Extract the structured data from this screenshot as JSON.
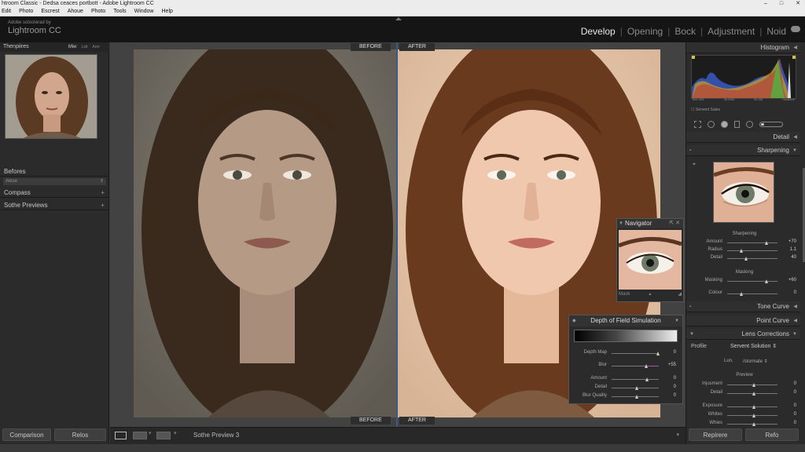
{
  "window": {
    "title": "htroom Classic - Dedsa ceaces portbott - Adobe Lightroom CC",
    "controls": [
      "–",
      "□",
      "✕"
    ]
  },
  "menu": [
    "Edit",
    "Photo",
    "Escrest",
    "Ahoue",
    "Photo",
    "Tools",
    "Window",
    "Help"
  ],
  "identity": {
    "small": "Adobe solosterad by",
    "big": "Lightroom CC"
  },
  "modules": [
    {
      "label": "Develop",
      "active": true
    },
    {
      "label": "Opening",
      "active": false
    },
    {
      "label": "Bock",
      "active": false
    },
    {
      "label": "Adjustment",
      "active": false
    },
    {
      "label": "Noid",
      "active": false
    }
  ],
  "left": {
    "nav_header": "Thenpiires",
    "nav_options": [
      "Miw",
      "Lstt",
      "Aorr"
    ],
    "befores": "Befores",
    "befores_sub": "Alese",
    "compass": "Compass",
    "previews": "Sothe Previews",
    "btn_comparison": "Comparison",
    "btn_relos": "Relos"
  },
  "center": {
    "label_before_top": "BEFORE",
    "label_after_top": "AFTER",
    "label_before_bottom": "BEFORE",
    "label_after_bottom": "AFTER"
  },
  "toolbar": {
    "text": "Sothe Preview 3"
  },
  "navigator": {
    "title": "Navigator",
    "footer": "Mask"
  },
  "dof": {
    "title": "Depth of Field Simulation",
    "rows": [
      {
        "label": "Depth Map",
        "value": "0",
        "pos": 0.95
      },
      {
        "label": "Blur",
        "value": "+55",
        "pos": 0.7
      },
      {
        "label": "Amount",
        "value": "0",
        "pos": 0.72
      },
      {
        "label": "Detail",
        "value": "0",
        "pos": 0.5
      },
      {
        "label": "Blur Quality",
        "value": "0",
        "pos": 0.5
      }
    ]
  },
  "right": {
    "histogram": "Histogram",
    "hist_labels": [
      "681.008",
      "45.08M",
      "90.3M",
      "Hisdiane"
    ],
    "sensor_check": "Servent Sales",
    "detail": "Detail",
    "sharpening": "Sharpening",
    "sharpen_group": "Sharpening",
    "sharpen_rows": [
      {
        "label": "Amount",
        "value": "+70",
        "pos": 0.75
      },
      {
        "label": "Radius",
        "value": "1.1",
        "pos": 0.25
      },
      {
        "label": "Detail",
        "value": "40",
        "pos": 0.35
      }
    ],
    "masking_group": "Masking",
    "masking_rows": [
      {
        "label": "Masking",
        "value": "+60",
        "pos": 0.75
      },
      {
        "label": "Colour",
        "value": "0",
        "pos": 0.25
      }
    ],
    "tone_curve": "Tone Curve",
    "point_curve": "Point Curve",
    "lens_corrections": "Lens Corrections",
    "profile_label": "Profile",
    "profile_value": "Servent Solution",
    "lun_label": "Lun.",
    "lun_value": "/stormate",
    "preview_group": "Preview",
    "preview_rows": [
      {
        "label": "Injusment",
        "value": "0",
        "pos": 0.5
      },
      {
        "label": "Detail",
        "value": "0",
        "pos": 0.5
      },
      {
        "label": "Exposure",
        "value": "0",
        "pos": 0.5
      },
      {
        "label": "Whites",
        "value": "0",
        "pos": 0.5
      },
      {
        "label": "Whies",
        "value": "0",
        "pos": 0.5
      }
    ],
    "btn_repirere": "Repirere",
    "btn_refo": "Refo"
  }
}
